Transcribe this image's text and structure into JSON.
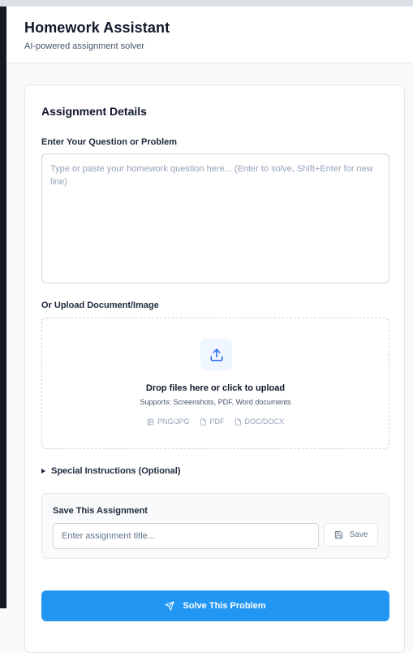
{
  "app": {
    "title": "Homework Assistant",
    "subtitle": "AI-powered assignment solver"
  },
  "card": {
    "title": "Assignment Details",
    "question_label": "Enter Your Question or Problem",
    "question_placeholder": "Type or paste your homework question here... (Enter to solve, Shift+Enter for new line)",
    "upload_label": "Or Upload Document/Image",
    "upload": {
      "icon": "upload-icon",
      "title": "Drop files here or click to upload",
      "supports": "Supports: Screenshots, PDF, Word documents",
      "file_types": [
        {
          "icon": "image-icon",
          "label": "PNG/JPG"
        },
        {
          "icon": "file-icon",
          "label": "PDF"
        },
        {
          "icon": "file-icon",
          "label": "DOC/DOCX"
        }
      ]
    },
    "special_instructions_label": "Special Instructions (Optional)",
    "save_section": {
      "title": "Save This Assignment",
      "input_placeholder": "Enter assignment title...",
      "save_label": "Save",
      "save_icon": "floppy-disk-icon"
    },
    "solve_label": "Solve This Problem",
    "solve_icon": "send-icon"
  },
  "colors": {
    "accent": "#2196f3",
    "upload_icon_bg": "#eff6ff",
    "text_primary": "#0f172a",
    "text_muted": "#94a3b8"
  }
}
